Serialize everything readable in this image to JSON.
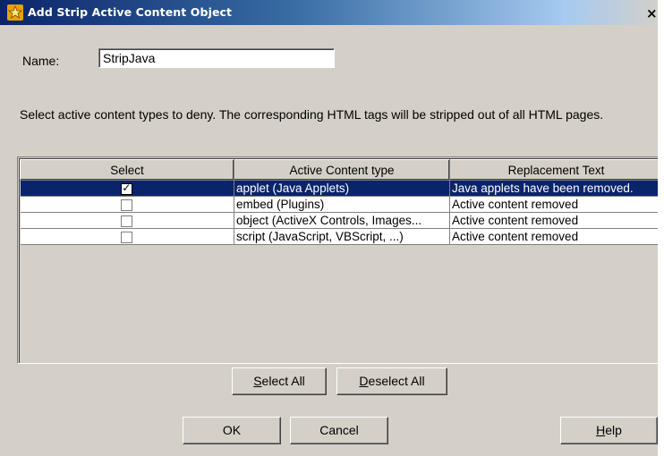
{
  "window": {
    "title": "Add Strip Active Content Object",
    "close": "×"
  },
  "name": {
    "label": "Name:",
    "value": "StripJava"
  },
  "instructions": "Select active content types to deny.  The corresponding HTML tags will be stripped out of all HTML pages.",
  "table": {
    "headers": [
      "Select",
      "Active Content type",
      "Replacement Text"
    ],
    "rows": [
      {
        "checked": true,
        "type": "applet (Java Applets)",
        "replacement": "Java applets have been removed."
      },
      {
        "checked": false,
        "type": "embed (Plugins)",
        "replacement": "Active content removed"
      },
      {
        "checked": false,
        "type": "object (ActiveX Controls, Images...",
        "replacement": "Active content removed"
      },
      {
        "checked": false,
        "type": "script (JavaScript, VBScript, ...)",
        "replacement": "Active content removed"
      }
    ]
  },
  "buttons": {
    "select_all": {
      "mnemonic": "S",
      "rest": "elect All"
    },
    "deselect_all": {
      "mnemonic": "D",
      "rest": "eselect All"
    },
    "ok": "OK",
    "cancel": "Cancel",
    "help": {
      "mnemonic": "H",
      "rest": "elp"
    }
  },
  "colors": {
    "selection": "#0a246a",
    "dialog_bg": "#d4d0c8"
  }
}
